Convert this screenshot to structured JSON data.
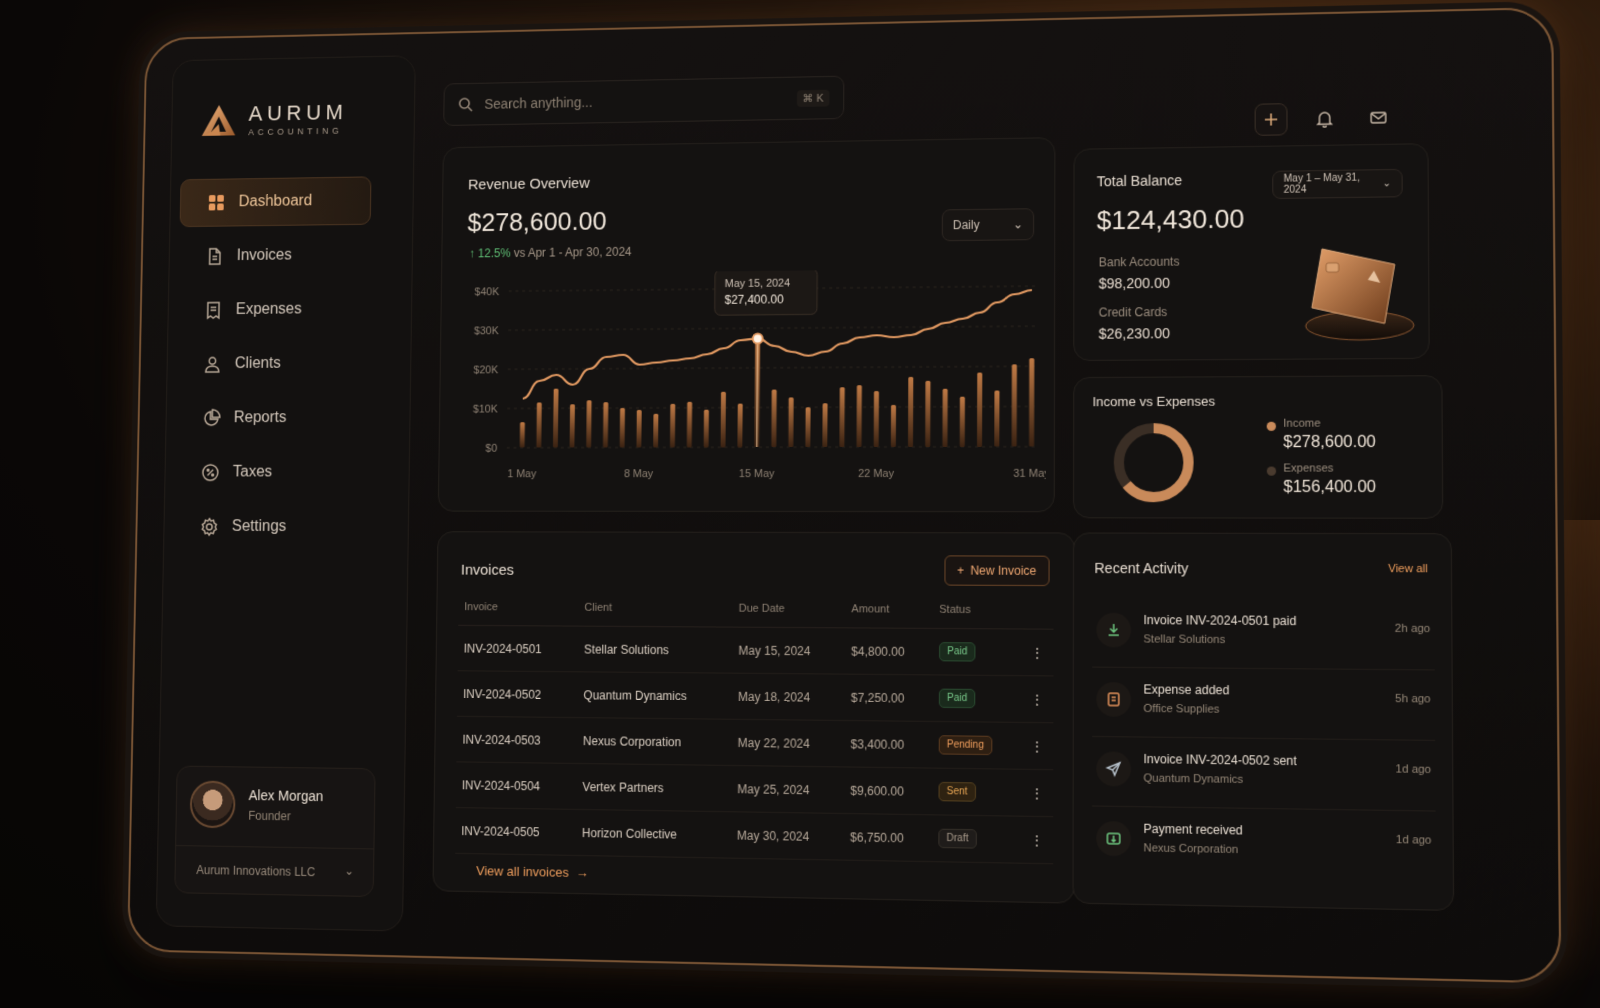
{
  "brand": {
    "name": "AURUM",
    "tagline": "ACCOUNTING"
  },
  "search": {
    "placeholder": "Search anything...",
    "shortcut": "⌘ K"
  },
  "sidebar": {
    "items": [
      {
        "label": "Dashboard",
        "icon": "grid-icon",
        "active": true
      },
      {
        "label": "Invoices",
        "icon": "document-icon"
      },
      {
        "label": "Expenses",
        "icon": "receipt-icon"
      },
      {
        "label": "Clients",
        "icon": "user-icon"
      },
      {
        "label": "Reports",
        "icon": "pie-chart-icon"
      },
      {
        "label": "Taxes",
        "icon": "percent-icon"
      },
      {
        "label": "Settings",
        "icon": "gear-icon"
      }
    ]
  },
  "profile": {
    "name": "Alex Morgan",
    "role": "Founder",
    "org": "Aurum Innovations LLC"
  },
  "revenue": {
    "title": "Revenue Overview",
    "value": "$278,600.00",
    "change": "12.5%",
    "comparison": "vs Apr 1 - Apr 30, 2024",
    "range": "Daily",
    "tooltip": {
      "date": "May 15, 2024",
      "value": "$27,400.00"
    }
  },
  "chart_data": {
    "type": "line",
    "ylabel": "",
    "ylim": [
      0,
      40000
    ],
    "y_ticks": [
      "$40K",
      "$30K",
      "$20K",
      "$10K",
      "$0"
    ],
    "x_ticks": [
      "1 May",
      "8 May",
      "15 May",
      "22 May",
      "31 May"
    ],
    "series": [
      {
        "type": "line",
        "values": [
          12500,
          17000,
          18500,
          16000,
          20000,
          23000,
          23500,
          21000,
          21500,
          22000,
          22500,
          23500,
          25000,
          27000,
          27400,
          25500,
          24000,
          23000,
          24000,
          26000,
          27500,
          28000,
          27500,
          28000,
          29500,
          31000,
          32000,
          33500,
          36000,
          38000,
          39000
        ]
      },
      {
        "type": "bar",
        "values": [
          6500,
          11500,
          15000,
          11000,
          12000,
          11500,
          10000,
          9500,
          8500,
          11000,
          11500,
          9500,
          14000,
          11000,
          27400,
          14500,
          12500,
          10000,
          11000,
          15000,
          15500,
          14000,
          10500,
          17500,
          16500,
          14500,
          12500,
          18500,
          14000,
          20500,
          22000
        ]
      }
    ]
  },
  "balance": {
    "title": "Total Balance",
    "range": "May 1 – May 31, 2024",
    "value": "$124,430.00",
    "bank_label": "Bank Accounts",
    "bank_value": "$98,200.00",
    "credit_label": "Credit Cards",
    "credit_value": "$26,230.00"
  },
  "ive": {
    "title": "Income vs Expenses",
    "income_label": "Income",
    "income_value": "$278,600.00",
    "expenses_label": "Expenses",
    "expenses_value": "$156,400.00",
    "income_fraction": 0.64,
    "colors": {
      "income": "#c98a5a",
      "expenses": "#3a2e25"
    }
  },
  "invoices": {
    "title": "Invoices",
    "new_label": "New Invoice",
    "columns": [
      "Invoice",
      "Client",
      "Due Date",
      "Amount",
      "Status"
    ],
    "rows": [
      {
        "id": "INV-2024-0501",
        "client": "Stellar Solutions",
        "due": "May 15, 2024",
        "amount": "$4,800.00",
        "status": "Paid",
        "kind": "paid"
      },
      {
        "id": "INV-2024-0502",
        "client": "Quantum Dynamics",
        "due": "May 18, 2024",
        "amount": "$7,250.00",
        "status": "Paid",
        "kind": "paid"
      },
      {
        "id": "INV-2024-0503",
        "client": "Nexus Corporation",
        "due": "May 22, 2024",
        "amount": "$3,400.00",
        "status": "Pending",
        "kind": "pending"
      },
      {
        "id": "INV-2024-0504",
        "client": "Vertex Partners",
        "due": "May 25, 2024",
        "amount": "$9,600.00",
        "status": "Sent",
        "kind": "sent"
      },
      {
        "id": "INV-2024-0505",
        "client": "Horizon Collective",
        "due": "May 30, 2024",
        "amount": "$6,750.00",
        "status": "Draft",
        "kind": "draft"
      }
    ],
    "view_all": "View all invoices"
  },
  "activity": {
    "title": "Recent Activity",
    "view_all": "View all",
    "items": [
      {
        "title": "Invoice INV-2024-0501 paid",
        "sub": "Stellar Solutions",
        "time": "2h ago",
        "icon": "download-icon",
        "color": "#6cc47e"
      },
      {
        "title": "Expense added",
        "sub": "Office Supplies",
        "time": "5h ago",
        "icon": "receipt-icon",
        "color": "#e0905a"
      },
      {
        "title": "Invoice INV-2024-0502 sent",
        "sub": "Quantum Dynamics",
        "time": "1d ago",
        "icon": "send-icon",
        "color": "#b7c2cc"
      },
      {
        "title": "Payment received",
        "sub": "Nexus Corporation",
        "time": "1d ago",
        "icon": "payment-icon",
        "color": "#6cc47e"
      }
    ]
  }
}
